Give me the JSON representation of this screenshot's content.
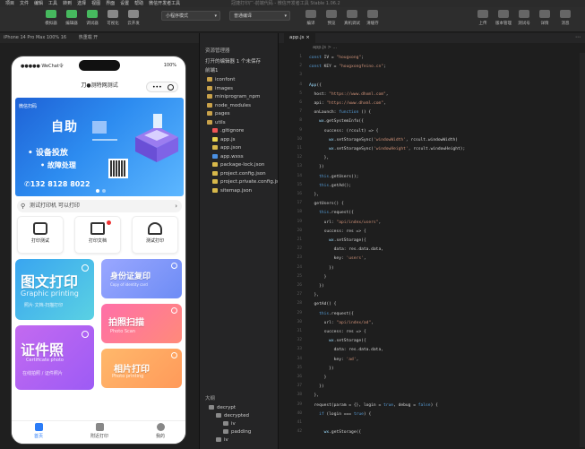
{
  "menu": [
    "项目",
    "文件",
    "编辑",
    "工具",
    "转到",
    "选择",
    "视图",
    "界面",
    "设置",
    "帮助",
    "微信开发者工具"
  ],
  "title_text": "冠捷打印厂-前端代码 - 微信开发者工具 Stable 1.06.2",
  "toolbar": {
    "left": [
      {
        "label": "模拟器",
        "color": "#46b95e"
      },
      {
        "label": "编辑器",
        "color": "#46b95e"
      },
      {
        "label": "调试器",
        "color": "#46b95e"
      },
      {
        "label": "可视化",
        "color": "#888"
      },
      {
        "label": "云开发",
        "color": "#888"
      }
    ],
    "mode_select": "小程序模式",
    "compile_select": "普通编译",
    "mid": [
      {
        "label": "编译"
      },
      {
        "label": "预览"
      },
      {
        "label": "真机调试"
      },
      {
        "label": "清缓存"
      }
    ],
    "right": [
      {
        "label": "上传"
      },
      {
        "label": "版本管理"
      },
      {
        "label": "测试号"
      },
      {
        "label": "详情"
      },
      {
        "label": "消息"
      }
    ]
  },
  "device_bar": {
    "device": "iPhone 14 Pro Max 100% 16",
    "network": "热重载 开"
  },
  "phone": {
    "status_left": "●●●●● WeChat令",
    "status_right": "100%",
    "nav_title": "刀●测特网测试",
    "banner": {
      "tag": "微信扫码",
      "title": "自助",
      "line1": "• 设备投放",
      "line2": "• 故障处理",
      "phone": "132 8128 8022"
    },
    "search_text": "测试打印机 可以打印",
    "quick": [
      {
        "label": "打印测试"
      },
      {
        "label": "打印文档"
      },
      {
        "label": "测试打印"
      }
    ],
    "cards": [
      {
        "title": "图文打印",
        "sub": "Graphic printing",
        "sub2": "照片·文档·扫描打印"
      },
      {
        "title": "身份证复印",
        "sub": "Copy of identity card"
      },
      {
        "title": "拍照扫描",
        "sub": "Photo Scan"
      },
      {
        "title": "证件照",
        "sub": "Certificate photo",
        "sub2": "在线拍照 / 证件照片"
      },
      {
        "title": "相片打印",
        "sub": "Photo printing"
      }
    ],
    "tabs": [
      {
        "label": "首页"
      },
      {
        "label": "附近打印"
      },
      {
        "label": "我的"
      }
    ]
  },
  "explorer": {
    "title": "资源管理器",
    "open_editors": "打开的编辑器 1 个未保存",
    "project": "前端1",
    "items": [
      {
        "name": "iconfont",
        "type": "folder"
      },
      {
        "name": "images",
        "type": "folder"
      },
      {
        "name": "miniprogram_npm",
        "type": "folder"
      },
      {
        "name": "node_modules",
        "type": "folder"
      },
      {
        "name": "pages",
        "type": "folder"
      },
      {
        "name": "utils",
        "type": "folder"
      },
      {
        "name": ".gitignore",
        "type": "git"
      },
      {
        "name": "app.js",
        "type": "js"
      },
      {
        "name": "app.json",
        "type": "json"
      },
      {
        "name": "app.wxss",
        "type": "wxss"
      },
      {
        "name": "package-lock.json",
        "type": "json"
      },
      {
        "name": "project.config.json",
        "type": "json"
      },
      {
        "name": "project.private.config.js...",
        "type": "json"
      },
      {
        "name": "sitemap.json",
        "type": "json"
      }
    ],
    "outline_title": "大纲",
    "outline": [
      {
        "name": "decrypt",
        "depth": 0
      },
      {
        "name": "decrypted",
        "depth": 1
      },
      {
        "name": "iv",
        "depth": 2
      },
      {
        "name": "padding",
        "depth": 2
      },
      {
        "name": "iv",
        "depth": 1
      }
    ]
  },
  "editor": {
    "tab": "app.js",
    "breadcrumb": "app.js > ...",
    "lines": [
      "1|const IV = \"hougxong\";",
      "2|const KEY = \"hougxongfeino.cn\";",
      "3|",
      "4|App({",
      "5|  host: \"https://www.dhxml.com\",",
      "6|  api: \"https://www.dhxml.com\",",
      "7|  onLaunch: function () {",
      "8|    wx.getSystemInfo({",
      "9|      success: (rcsult) => {",
      "10|        wx.setStorageSync('windowWidth', rcsult.windowWidth)",
      "11|        wx.setStorageSync('windowHeight', rcsult.windowHeight);",
      "12|      },",
      "13|    })",
      "14|    this.getUsers();",
      "15|    this.getAd();",
      "16|  },",
      "17|  getUsers() {",
      "18|    this.request({",
      "19|      url: \"api/index/users\",",
      "20|      success: res => {",
      "21|        wx.setStorage({",
      "22|          data: res.data.data,",
      "23|          key: 'users',",
      "24|        })",
      "25|      }",
      "26|    })",
      "27|  },",
      "28|  getAd() {",
      "29|    this.request({",
      "30|      url: \"api/index/ad\",",
      "31|      success: res => {",
      "32|        wx.setStorage({",
      "33|          data: res.data.data,",
      "34|          key: 'ad',",
      "35|        })",
      "36|      }",
      "37|    })",
      "38|  },",
      "39|  request(param = {}, login = true, debug = false) {",
      "40|    if (login === true) {",
      "41|",
      "42|      wx.getStorage({"
    ]
  }
}
